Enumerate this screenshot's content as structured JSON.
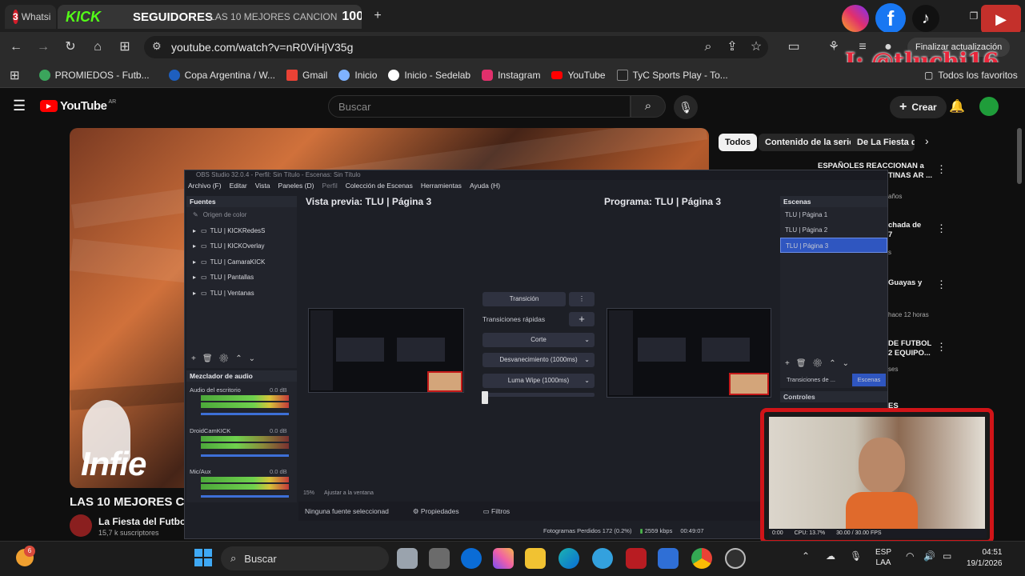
{
  "browser": {
    "tabs": [
      {
        "label": "Whatsi",
        "badge": "3"
      },
      {
        "label": "LAS 10 MEJORES CANCION"
      }
    ],
    "overlay_tab_text": {
      "kick": "KICK",
      "followers": "SEGUIDORES",
      "count": "100"
    },
    "url": "youtube.com/watch?v=nR0ViHjV35g",
    "update_label": "Finalizar actualización",
    "bookmarks": [
      {
        "label": "PROMIEDOS - Futb...",
        "color": "#3ba55c"
      },
      {
        "label": "Copa Argentina / W...",
        "color": "#1e5fbf"
      },
      {
        "label": "Gmail",
        "color": "#e94235"
      },
      {
        "label": "Inicio",
        "color": "#7fb2ff"
      },
      {
        "label": "Inicio - Sedelab",
        "color": "#ffffff"
      },
      {
        "label": "Instagram",
        "color": "#e1306c"
      },
      {
        "label": "YouTube",
        "color": "#ff0000"
      },
      {
        "label": "TyC Sports Play - To...",
        "color": "#222222"
      }
    ],
    "all_favorites": "Todos los favoritos",
    "watermark": "I: @tluchi16"
  },
  "youtube": {
    "logo": "YouTube",
    "region": "AR",
    "search_placeholder": "Buscar",
    "create_label": "Crear",
    "chips": [
      "Todos",
      "Contenido de la serie",
      "De La Fiesta del"
    ],
    "video_title": "LAS 10 MEJORES CAN",
    "channel_name": "La Fiesta del Futbol",
    "subscribers": "15,7 k suscriptores",
    "video_overlay_text": "Infie",
    "recs": [
      {
        "title": "ESPAÑOLES REACCIONAN a",
        "title2": "TINAS AR ...",
        "meta": "años"
      },
      {
        "title": "chada de",
        "title2": "7",
        "meta": "s"
      },
      {
        "title": "Guayas y",
        "title2": "",
        "meta": "hace 12 horas"
      },
      {
        "title": "DE FUTBOL",
        "title2": "2 EQUIPO...",
        "meta": "ses"
      },
      {
        "title": "ES",
        "title2": "",
        "meta": ""
      }
    ]
  },
  "obs": {
    "title": "OBS Studio 32.0.4 - Perfil: Sin Título - Escenas: Sin Título",
    "menu": [
      "Archivo (F)",
      "Editar",
      "Vista",
      "Paneles (D)",
      "Perfil",
      "Colección de Escenas",
      "Herramientas",
      "Ayuda (H)"
    ],
    "sources_header": "Fuentes",
    "sources": [
      "Origen de color",
      "TLU | KICKRedesS",
      "TLU | KICKOverlay",
      "TLU | CamaraKICK",
      "TLU | Pantallas",
      "TLU | Ventanas"
    ],
    "preview_label": "Vista previa: TLU | Página 3",
    "program_label": "Programa: TLU | Página 3",
    "scenes_header": "Escenas",
    "scenes": [
      "TLU | Página 1",
      "TLU | Página 2",
      "TLU | Página 3"
    ],
    "transition_btn": "Transición",
    "quick_transitions": "Transiciones rápidas",
    "transitions": [
      "Corte",
      "Desvanecimiento (1000ms)",
      "Luma Wipe (1000ms)"
    ],
    "mixer_header": "Mezclador de audio",
    "mixer": [
      {
        "name": "Audio del escritorio",
        "db": "0.0 dB"
      },
      {
        "name": "DroidCamKICK",
        "db": "0.0 dB"
      },
      {
        "name": "Mic/Aux",
        "db": "0.0 dB"
      }
    ],
    "scene_transitions_tab": "Transiciones de ...",
    "scenes_tab": "Escenas",
    "controls_header": "Controles",
    "zoom": "15%",
    "fit_window": "Ajustar a la ventana",
    "no_source": "Ninguna fuente seleccionad",
    "properties": "Propiedades",
    "filters": "Filtros",
    "status": {
      "dropped": "Fotogramas Perdidos 172 (0.2%)",
      "kbps": "2559 kbps",
      "time": "00:49:07",
      "time2": "0:00",
      "cpu": "CPU: 13.7%",
      "fps": "30.00 / 30.00 FPS"
    }
  },
  "taskbar": {
    "search_label": "Buscar",
    "notification_count": "6",
    "lang": "ESP",
    "lang2": "LAA",
    "time": "04:51",
    "date": "19/1/2026"
  }
}
